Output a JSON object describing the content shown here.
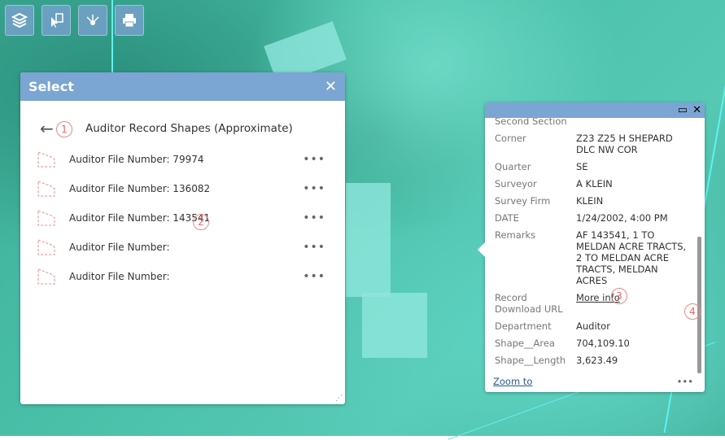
{
  "toolbar": {
    "buttons": [
      {
        "icon": "layers-icon"
      },
      {
        "icon": "select-icon"
      },
      {
        "icon": "share-icon"
      },
      {
        "icon": "print-icon"
      }
    ]
  },
  "select_panel": {
    "title": "Select",
    "close": "✕",
    "back": "←",
    "layer_title": "Auditor Record Shapes (Approximate)",
    "items": [
      {
        "label": "Auditor File Number: 79974",
        "more": "•••"
      },
      {
        "label": "Auditor File Number: 136082",
        "more": "•••"
      },
      {
        "label": "Auditor File Number: 143541",
        "more": "•••"
      },
      {
        "label": "Auditor File Number:",
        "more": "•••"
      },
      {
        "label": "Auditor File Number:",
        "more": "•••"
      }
    ],
    "shape_color": "#f08a8a"
  },
  "popup": {
    "partial_label": "Second Section",
    "fields": [
      {
        "k": "Corner",
        "v": "Z23 Z25 H SHEPARD DLC NW COR"
      },
      {
        "k": "Quarter",
        "v": "SE"
      },
      {
        "k": "Surveyor",
        "v": "A KLEIN"
      },
      {
        "k": "Survey Firm",
        "v": "KLEIN"
      },
      {
        "k": "DATE",
        "v": "1/24/2002, 4:00 PM"
      },
      {
        "k": "Remarks",
        "v": "AF 143541, 1 TO MELDAN ACRE TRACTS, 2 TO MELDAN ACRE TRACTS, MELDAN ACRES"
      },
      {
        "k": "Record Download URL",
        "v": "More info"
      },
      {
        "k": "Department",
        "v": "Auditor"
      },
      {
        "k": "Shape__Area",
        "v": "704,109.10"
      },
      {
        "k": "Shape__Length",
        "v": "3,623.49"
      }
    ],
    "zoom_to": "Zoom to",
    "more": "•••",
    "maximize": "▭",
    "close": "✕"
  },
  "annotations": [
    "1",
    "2",
    "3",
    "4"
  ],
  "colors": {
    "header": "#7ba5d3",
    "annotation": "#e66666"
  }
}
